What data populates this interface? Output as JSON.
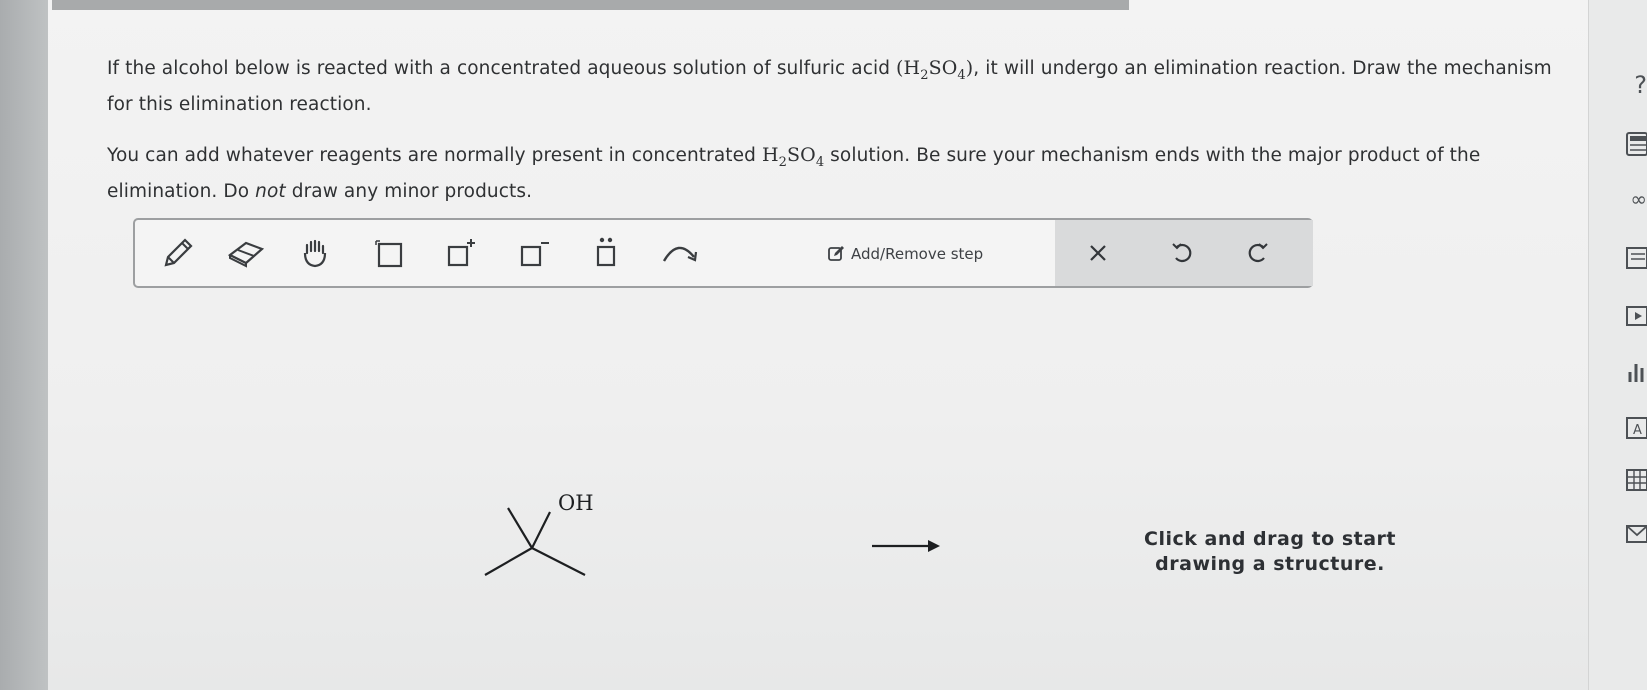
{
  "question": {
    "p1_a": "If the alcohol below is reacted with a concentrated aqueous solution of sulfuric acid ",
    "p1_formula_open": "(H",
    "p1_formula_sub1": "2",
    "p1_formula_mid": "SO",
    "p1_formula_sub2": "4",
    "p1_formula_close": ")",
    "p1_b": ", it will undergo an elimination reaction. Draw the mechanism for this elimination reaction.",
    "p2_a": "You can add whatever reagents are normally present in concentrated ",
    "p2_formula_h": "H",
    "p2_formula_sub1": "2",
    "p2_formula_so": "SO",
    "p2_formula_sub2": "4",
    "p2_b": " solution. Be sure your mechanism ends with the major product of the elimination. Do ",
    "p2_not": "not",
    "p2_c": " draw any minor products."
  },
  "toolbar": {
    "tools": [
      "pencil-icon",
      "eraser-icon",
      "hand-icon",
      "select-box-icon",
      "positive-charge-icon",
      "negative-charge-icon",
      "lone-pair-icon",
      "curved-arrow-icon"
    ],
    "add_remove_label": "Add/Remove step",
    "actions": [
      "clear-icon",
      "undo-icon",
      "redo-icon"
    ]
  },
  "molecule": {
    "oh_label": "OH"
  },
  "canvas": {
    "hint": "Click and drag to start drawing a structure."
  },
  "right_rail": {
    "icons": [
      "help-icon",
      "calculator-icon",
      "infinity-icon",
      "notes-icon",
      "video-icon",
      "chart-icon",
      "text-icon",
      "periodic-table-icon",
      "mail-icon"
    ]
  }
}
